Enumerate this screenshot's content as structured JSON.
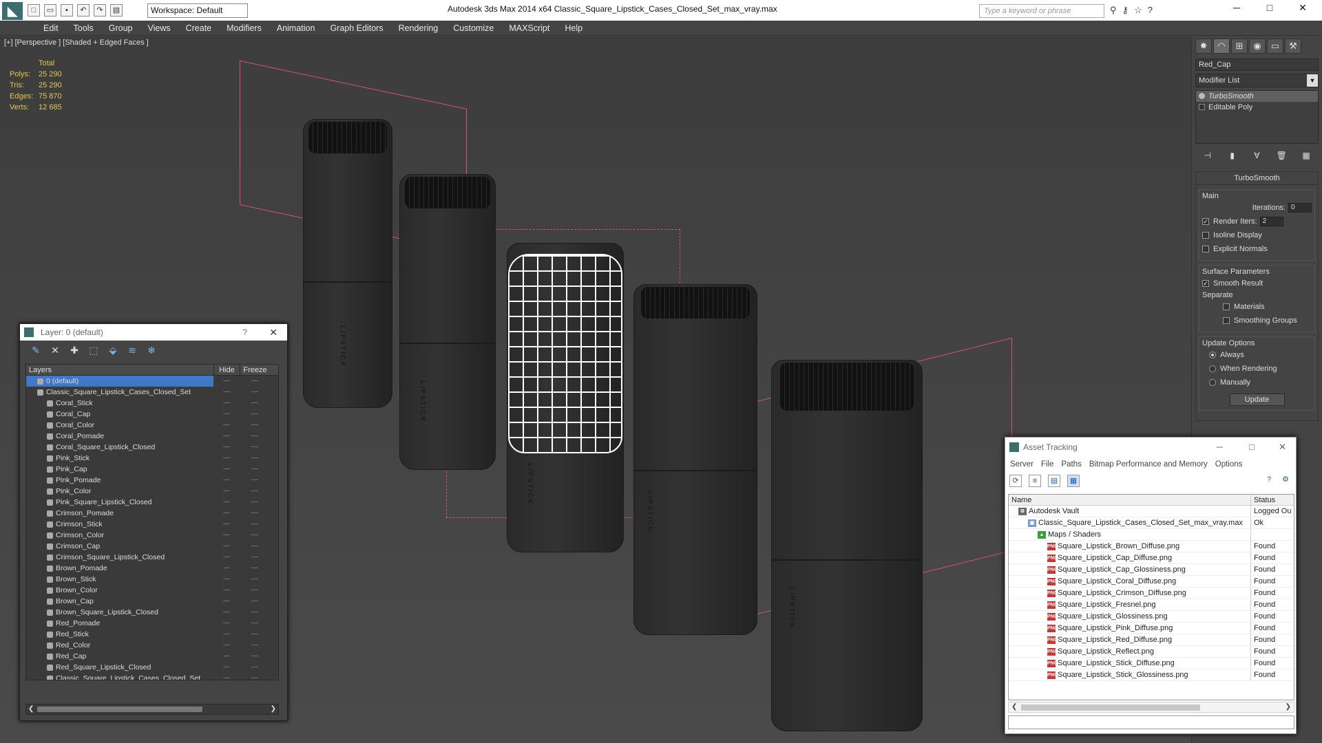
{
  "app": {
    "title": "Autodesk 3ds Max  2014 x64      Classic_Square_Lipstick_Cases_Closed_Set_max_vray.max",
    "workspace": "Workspace: Default",
    "search_placeholder": "Type a keyword or phrase"
  },
  "menu": [
    "Edit",
    "Tools",
    "Group",
    "Views",
    "Create",
    "Modifiers",
    "Animation",
    "Graph Editors",
    "Rendering",
    "Customize",
    "MAXScript",
    "Help"
  ],
  "viewport": {
    "label": "[+] [Perspective ] [Shaded + Edged Faces ]",
    "stats_header": "Total",
    "stats": [
      {
        "k": "Polys:",
        "v": "25 290"
      },
      {
        "k": "Tris:",
        "v": "25 290"
      },
      {
        "k": "Edges:",
        "v": "75 870"
      },
      {
        "k": "Verts:",
        "v": "12 685"
      }
    ],
    "mark_text": "LIPSTICK"
  },
  "command_panel": {
    "object_name": "Red_Cap",
    "modifier_list": "Modifier List",
    "stack": [
      "TurboSmooth",
      "Editable Poly"
    ],
    "rollout_title": "TurboSmooth",
    "main_label": "Main",
    "iterations_label": "Iterations:",
    "iterations_value": "0",
    "render_iters_label": "Render Iters:",
    "render_iters_value": "2",
    "isoline": "Isoline Display",
    "explicit": "Explicit Normals",
    "surface_label": "Surface Parameters",
    "smooth_result": "Smooth Result",
    "separate_label": "Separate",
    "materials": "Materials",
    "smoothing_groups": "Smoothing Groups",
    "update_label": "Update Options",
    "always": "Always",
    "when_rendering": "When Rendering",
    "manually": "Manually",
    "update_button": "Update"
  },
  "layer_window": {
    "title": "Layer: 0 (default)",
    "help": "?",
    "columns": {
      "layers": "Layers",
      "hide": "Hide",
      "freeze": "Freeze"
    },
    "rows": [
      {
        "name": "0 (default)",
        "level": 0,
        "sel": true
      },
      {
        "name": "Classic_Square_Lipstick_Cases_Closed_Set",
        "level": 0
      },
      {
        "name": "Coral_Stick",
        "level": 1
      },
      {
        "name": "Coral_Cap",
        "level": 1
      },
      {
        "name": "Coral_Color",
        "level": 1
      },
      {
        "name": "Coral_Pomade",
        "level": 1
      },
      {
        "name": "Coral_Square_Lipstick_Closed",
        "level": 1
      },
      {
        "name": "Pink_Stick",
        "level": 1
      },
      {
        "name": "Pink_Cap",
        "level": 1
      },
      {
        "name": "Pink_Pomade",
        "level": 1
      },
      {
        "name": "Pink_Color",
        "level": 1
      },
      {
        "name": "Pink_Square_Lipstick_Closed",
        "level": 1
      },
      {
        "name": "Crimson_Pomade",
        "level": 1
      },
      {
        "name": "Crimson_Stick",
        "level": 1
      },
      {
        "name": "Crimson_Color",
        "level": 1
      },
      {
        "name": "Crimson_Cap",
        "level": 1
      },
      {
        "name": "Crimson_Square_Lipstick_Closed",
        "level": 1
      },
      {
        "name": "Brown_Pomade",
        "level": 1
      },
      {
        "name": "Brown_Stick",
        "level": 1
      },
      {
        "name": "Brown_Color",
        "level": 1
      },
      {
        "name": "Brown_Cap",
        "level": 1
      },
      {
        "name": "Brown_Square_Lipstick_Closed",
        "level": 1
      },
      {
        "name": "Red_Pomade",
        "level": 1
      },
      {
        "name": "Red_Stick",
        "level": 1
      },
      {
        "name": "Red_Color",
        "level": 1
      },
      {
        "name": "Red_Cap",
        "level": 1
      },
      {
        "name": "Red_Square_Lipstick_Closed",
        "level": 1
      },
      {
        "name": "Classic_Square_Lipstick_Cases_Closed_Set",
        "level": 1
      }
    ]
  },
  "asset_window": {
    "title": "Asset Tracking",
    "menu": [
      "Server",
      "File",
      "Paths",
      "Bitmap Performance and Memory",
      "Options"
    ],
    "columns": {
      "name": "Name",
      "status": "Status"
    },
    "rows": [
      {
        "name": "Autodesk Vault",
        "status": "Logged Ou",
        "level": 0,
        "icon": "vault"
      },
      {
        "name": "Classic_Square_Lipstick_Cases_Closed_Set_max_vray.max",
        "status": "Ok",
        "level": 1,
        "icon": "max"
      },
      {
        "name": "Maps / Shaders",
        "status": "",
        "level": 2,
        "icon": "maps"
      },
      {
        "name": "Square_Lipstick_Brown_Diffuse.png",
        "status": "Found",
        "level": 3,
        "icon": "png"
      },
      {
        "name": "Square_Lipstick_Cap_Diffuse.png",
        "status": "Found",
        "level": 3,
        "icon": "png"
      },
      {
        "name": "Square_Lipstick_Cap_Glossiness.png",
        "status": "Found",
        "level": 3,
        "icon": "png"
      },
      {
        "name": "Square_Lipstick_Coral_Diffuse.png",
        "status": "Found",
        "level": 3,
        "icon": "png"
      },
      {
        "name": "Square_Lipstick_Crimson_Diffuse.png",
        "status": "Found",
        "level": 3,
        "icon": "png"
      },
      {
        "name": "Square_Lipstick_Fresnel.png",
        "status": "Found",
        "level": 3,
        "icon": "png"
      },
      {
        "name": "Square_Lipstick_Glossiness.png",
        "status": "Found",
        "level": 3,
        "icon": "png"
      },
      {
        "name": "Square_Lipstick_Pink_Diffuse.png",
        "status": "Found",
        "level": 3,
        "icon": "png"
      },
      {
        "name": "Square_Lipstick_Red_Diffuse.png",
        "status": "Found",
        "level": 3,
        "icon": "png"
      },
      {
        "name": "Square_Lipstick_Reflect.png",
        "status": "Found",
        "level": 3,
        "icon": "png"
      },
      {
        "name": "Square_Lipstick_Stick_Diffuse.png",
        "status": "Found",
        "level": 3,
        "icon": "png"
      },
      {
        "name": "Square_Lipstick_Stick_Glossiness.png",
        "status": "Found",
        "level": 3,
        "icon": "png"
      }
    ]
  },
  "colors": {
    "selection": "#3f78c8",
    "bbox": "#d94f86",
    "stats": "#e6c84a",
    "brand": "#3c6e70"
  }
}
